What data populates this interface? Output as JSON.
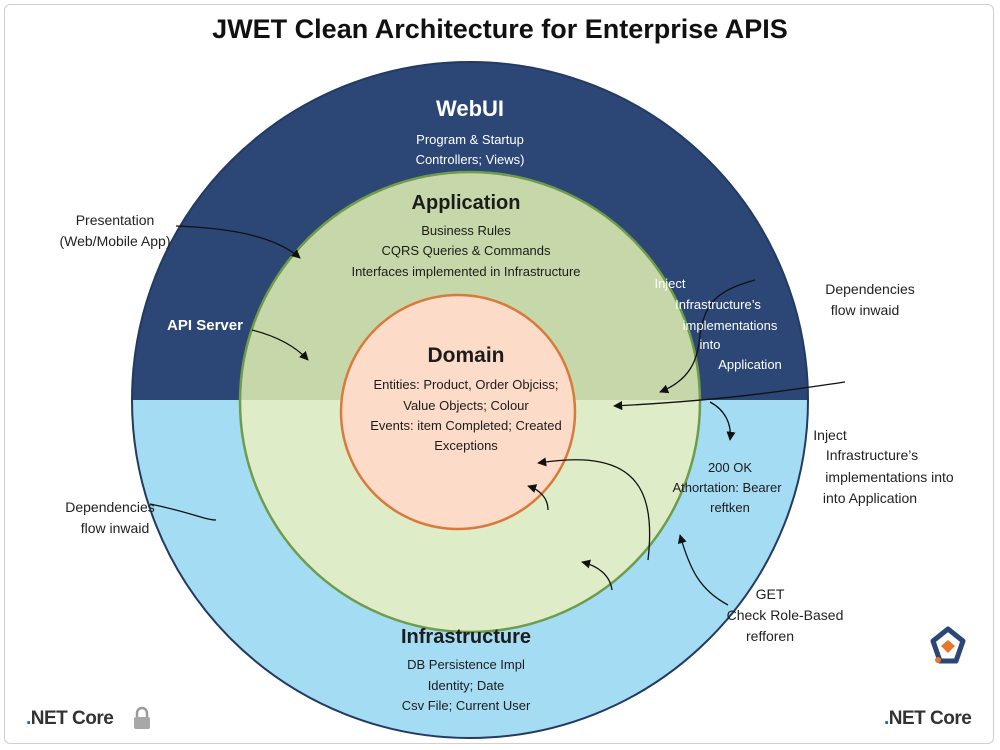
{
  "title": "JWET Clean Architecture for Enterprise APIS",
  "colors": {
    "webui_fill": "#2c4676",
    "infrastructure_fill": "#a4dcf3",
    "application_fill": "#c6d8a9",
    "application_lower_fill": "#deecc8",
    "domain_fill": "#fcdcc8",
    "domain_border": "#d97a3a",
    "application_border": "#6f9c4a"
  },
  "rings": {
    "webui": {
      "title": "WebUI",
      "lines": [
        "Program & Startup",
        "Controllers; Views)"
      ]
    },
    "application": {
      "title": "Application",
      "lines": [
        "Business Rules",
        "CQRS Queries & Commands",
        "Interfaces implemented in Infrastructure"
      ]
    },
    "domain": {
      "title": "Domain",
      "lines": [
        "Entities: Product, Order Objciss;",
        "Value Objects; Colour",
        "Events: item Completed; Created",
        "Exceptions"
      ]
    },
    "infrastructure": {
      "title": "Infrastructure",
      "lines": [
        "DB Persistence Impl",
        "Identity; Date",
        "Csv File; Current User"
      ]
    }
  },
  "inner_labels": {
    "api_server": "API Server",
    "inject_upper": [
      "Inject",
      "Infrastructure’s",
      "implementations",
      "into",
      "Application"
    ],
    "auth": [
      "200 OK",
      "Athortation: Bearer",
      "reftken"
    ]
  },
  "outer_labels": {
    "presentation": [
      "Presentation",
      "(Web/Mobile App)"
    ],
    "dependencies_right": [
      "Dependencies",
      "flow inwaid"
    ],
    "inject_right": [
      "Inject",
      "Infrastructure’s",
      "implementations into",
      "into Application"
    ],
    "dependencies_left": [
      "Dependencies",
      "flow inwaid"
    ],
    "get_check": [
      "GET",
      "Check Role-Based",
      "refforen"
    ]
  },
  "footer": {
    "left_brand": ".NET Core",
    "right_brand": ".NET Core"
  },
  "icons": [
    "lock-icon",
    "logo-icon"
  ]
}
